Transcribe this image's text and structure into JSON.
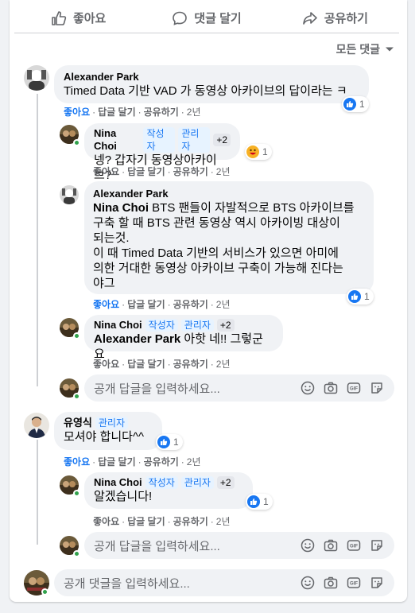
{
  "actions": {
    "like": "좋아요",
    "comment": "댓글 달기",
    "share": "공유하기"
  },
  "sort_label": "모든 댓글",
  "comments": [
    {
      "author": "Alexander Park",
      "text": "Timed Data 기반 VAD 가 동영상 아카이브의 답이라는 ㅋ",
      "like": "좋아요",
      "reply": "답글 달기",
      "share": "공유하기",
      "time": "2년",
      "reactions": "1",
      "replies": [
        {
          "author": "Nina Choi",
          "badge1": "작성자",
          "badge2": "관리자",
          "badge3": "+2",
          "text": "넹? 갑자기 동영상아카이브?",
          "like": "좋아요",
          "reply": "답글 달기",
          "share": "공유하기",
          "time": "2년",
          "reactions": "1"
        },
        {
          "author": "Alexander Park",
          "mention": "Nina Choi",
          "lines": [
            "BTS 팬들이 자발적으로 BTS 아카이브를",
            "구축 할 때 BTS 관련 동영상 역시 아카이빙 대상이",
            "되는것.",
            "이 때 Timed Data 기반의 서비스가 있으면 아미에",
            "의한 거대한 동영상 아카이브 구축이 가능해 진다는",
            "야그"
          ],
          "like": "좋아요",
          "reply": "답글 달기",
          "share": "공유하기",
          "time": "2년",
          "reactions": "1"
        },
        {
          "author": "Nina Choi",
          "badge1": "작성자",
          "badge2": "관리자",
          "badge3": "+2",
          "mention": "Alexander Park",
          "text": "아핫 네!! 그렇군요",
          "like": "좋아요",
          "reply": "답글 달기",
          "share": "공유하기",
          "time": "2년"
        }
      ],
      "reply_placeholder": "공개 답글을 입력하세요..."
    },
    {
      "author": "유영식",
      "badge1": "관리자",
      "text": "모셔야 합니다^^",
      "like": "좋아요",
      "reply": "답글 달기",
      "share": "공유하기",
      "time": "2년",
      "reactions": "1",
      "replies": [
        {
          "author": "Nina Choi",
          "badge1": "작성자",
          "badge2": "관리자",
          "badge3": "+2",
          "text": "알겠습니다!",
          "like": "좋아요",
          "reply": "답글 달기",
          "share": "공유하기",
          "time": "2년",
          "reactions": "1"
        }
      ],
      "reply_placeholder": "공개 답글을 입력하세요..."
    }
  ],
  "comment_placeholder": "공개 댓글을 입력하세요...",
  "colors": {
    "accent": "#1877f2",
    "online": "#31a24c",
    "bubble": "#f0f2f5",
    "muted": "#65676b"
  }
}
